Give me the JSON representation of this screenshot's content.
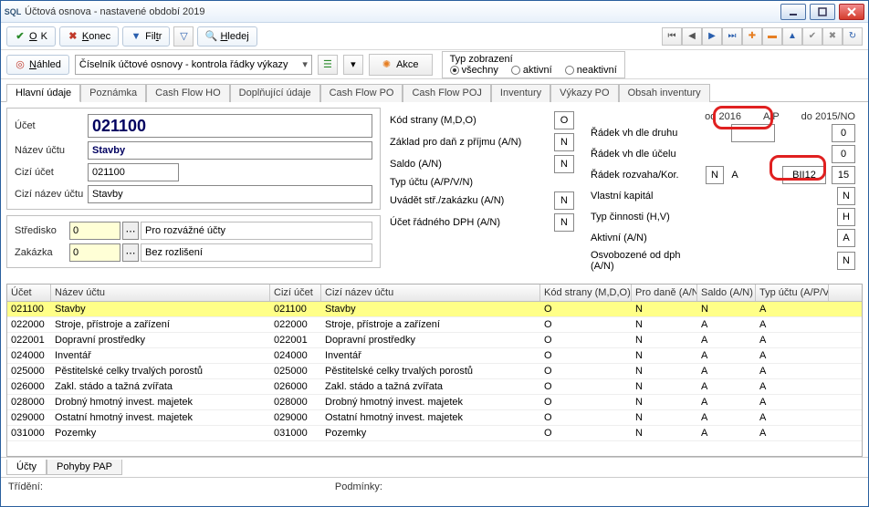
{
  "window": {
    "title": "Účtová osnova - nastavené období 2019"
  },
  "toolbar": {
    "ok": "OK",
    "konec": "Konec",
    "filtr": "Filtr",
    "hledej": "Hledej",
    "nahled": "Náhled",
    "combo": "Číselník účtové osnovy - kontrola řádky výkazy",
    "akce": "Akce",
    "typ_label": "Typ zobrazení",
    "r_vsechny": "všechny",
    "r_aktivni": "aktivní",
    "r_neaktivni": "neaktivní"
  },
  "tabs": [
    "Hlavní údaje",
    "Poznámka",
    "Cash Flow HO",
    "Doplňující údaje",
    "Cash Flow PO",
    "Cash Flow POJ",
    "Inventury",
    "Výkazy PO",
    "Obsah inventury"
  ],
  "form": {
    "ucet_l": "Účet",
    "ucet": "021100",
    "nazev_l": "Název účtu",
    "nazev": "Stavby",
    "cizi_l": "Cizí účet",
    "cizi": "021100",
    "cizinaz_l": "Cizí název účtu",
    "cizinaz": "Stavby",
    "stred_l": "Středisko",
    "stred_code": "0",
    "stred_desc": "Pro rozvážné účty",
    "zak_l": "Zakázka",
    "zak_code": "0",
    "zak_desc": "Bez rozlišení"
  },
  "mid": {
    "kod_l": "Kód strany (M,D,O)",
    "kod": "O",
    "zaklad_l": "Základ pro daň z příjmu (A/N)",
    "zaklad": "N",
    "saldo_l": "Saldo (A/N)",
    "saldo": "N",
    "typ_l": "Typ účtu (A/P/V/N)",
    "uvadet_l": "Uvádět stř./zakázku (A/N)",
    "uvadet": "N",
    "dph_l": "Účet řádného DPH (A/N)",
    "dph": "N"
  },
  "right": {
    "hdr_od": "od 2016",
    "hdr_ap": "A/P",
    "hdr_do": "do 2015/NO",
    "r1_l": "Řádek vh dle druhu",
    "r1_do": "0",
    "r2_l": "Řádek vh dle účelu",
    "r2_do": "0",
    "r3_l": "Řádek rozvaha/Kor.",
    "r3_a": "N",
    "r3_b": "A",
    "r3_c": "BII12",
    "r3_d": "15",
    "r4_l": "Vlastní kapitál",
    "r4": "N",
    "r5_l": "Typ činnosti (H,V)",
    "r5": "H",
    "r6_l": "Aktivní (A/N)",
    "r6": "A",
    "r7_l": "Osvobozené od dph (A/N)",
    "r7": "N"
  },
  "grid": {
    "headers": [
      "Účet",
      "Název účtu",
      "Cizí účet",
      "Cizí název účtu",
      "Kód strany (M,D,O)",
      "Pro daně (A/N)",
      "Saldo (A/N)",
      "Typ účtu (A/P/V"
    ],
    "rows": [
      [
        "021100",
        "Stavby",
        "021100",
        "Stavby",
        "O",
        "N",
        "N",
        "A"
      ],
      [
        "022000",
        "Stroje, přístroje a zařízení",
        "022000",
        "Stroje, přístroje a zařízení",
        "O",
        "N",
        "A",
        "A"
      ],
      [
        "022001",
        "Dopravní prostředky",
        "022001",
        "Dopravní prostředky",
        "O",
        "N",
        "A",
        "A"
      ],
      [
        "024000",
        "Inventář",
        "024000",
        "Inventář",
        "O",
        "N",
        "A",
        "A"
      ],
      [
        "025000",
        "Pěstitelské celky trvalých porostů",
        "025000",
        "Pěstitelské celky trvalých porostů",
        "O",
        "N",
        "A",
        "A"
      ],
      [
        "026000",
        "Zakl. stádo a tažná zvířata",
        "026000",
        "Zakl. stádo a tažná zvířata",
        "O",
        "N",
        "A",
        "A"
      ],
      [
        "028000",
        "Drobný hmotný invest. majetek",
        "028000",
        "Drobný hmotný invest. majetek",
        "O",
        "N",
        "A",
        "A"
      ],
      [
        "029000",
        "Ostatní hmotný invest. majetek",
        "029000",
        "Ostatní hmotný invest. majetek",
        "O",
        "N",
        "A",
        "A"
      ],
      [
        "031000",
        "Pozemky",
        "031000",
        "Pozemky",
        "O",
        "N",
        "A",
        "A"
      ]
    ]
  },
  "bottom_tabs": [
    "Účty",
    "Pohyby PAP"
  ],
  "status": {
    "trideni": "Třídění:",
    "podminky": "Podmínky:"
  }
}
